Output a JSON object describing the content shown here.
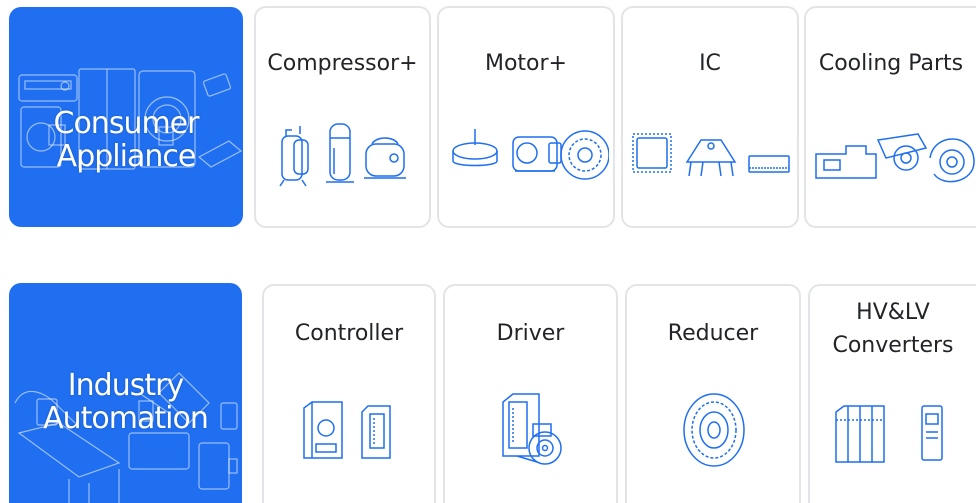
{
  "colors": {
    "accent": "#1f6ff0",
    "line": "#1f6ff0",
    "card_border": "#e2e4e8",
    "text": "#222428"
  },
  "row1": {
    "hero": {
      "line1": "Consumer",
      "line2": "Appliance"
    },
    "cards": [
      {
        "label": "Compressor+",
        "icon": "compressor-icon"
      },
      {
        "label": "Motor+",
        "icon": "motor-icon"
      },
      {
        "label": "IC",
        "icon": "chip-icon"
      },
      {
        "label": "Cooling Parts",
        "icon": "fan-housing-icon"
      }
    ]
  },
  "row2": {
    "hero": {
      "line1": "Industry",
      "line2": "Automation"
    },
    "cards": [
      {
        "label": "Controller",
        "icon": "controller-icon"
      },
      {
        "label": "Driver",
        "icon": "servo-driver-icon"
      },
      {
        "label": "Reducer",
        "icon": "reducer-icon"
      },
      {
        "label_line1": "HV&LV",
        "label_line2": "Converters",
        "icon": "converter-cabinet-icon"
      }
    ]
  }
}
